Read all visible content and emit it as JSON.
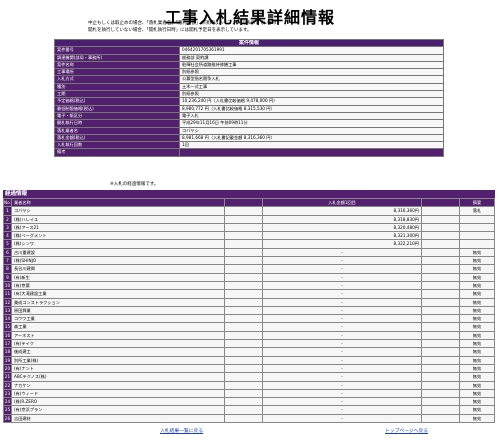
{
  "title": "工事入札結果詳細情報",
  "notes": [
    "中止もしくは取止めの場合、「落札業者名」「落札金額」の項目はハイフン(-)で表示しています。",
    "開札を執行していない場合、「開札執行日時」には開札予定日を表示しています。"
  ],
  "info": {
    "header": "案件情報",
    "rows": [
      {
        "label": "案件番号",
        "value": "0464201705361991"
      },
      {
        "label": "調達機関(部局・事務所)",
        "value": "総務部 契約課"
      },
      {
        "label": "案件名称",
        "value": "駐輝社会所道路維持修繕工事"
      },
      {
        "label": "工事場所",
        "value": "別紙参照"
      },
      {
        "label": "入札方式",
        "value": "公募型指名競争入札"
      },
      {
        "label": "種別",
        "value": "土木一式工事"
      },
      {
        "label": "工期",
        "value": "別紙参照"
      },
      {
        "label": "予定価格(税込)",
        "value": "10,236,240 円（入札書比較価格 9,478,000 円）"
      },
      {
        "label": "最低制限価格(税込)",
        "value": "8,980,772 円（入札書比較価格 8,315,530 円）"
      },
      {
        "label": "電子・紙区分",
        "value": "電子入札"
      },
      {
        "label": "開札執行日時",
        "value": "平成29年11月16日 午前09時11分"
      },
      {
        "label": "落札業者名",
        "value": "コバヤシ"
      },
      {
        "label": "落札金額(税込)",
        "value": "8,981,668 円（入札書記載金額 8,316,360 円）"
      },
      {
        "label": "入札執行回数",
        "value": "1回"
      },
      {
        "label": "備考",
        "value": ""
      }
    ]
  },
  "kc_note": "※入札の経過情報です。",
  "bids": {
    "section_title": "経過情報",
    "col_no": "No.",
    "col_name": "業者名称",
    "col_amount": "入札金額1回目",
    "col_remark": "摘要",
    "rows": [
      {
        "no": "1",
        "name": "コバヤシ",
        "amount": "8,316,360円",
        "remark": "落札"
      },
      {
        "no": "2",
        "name": "(株)ハレイユ",
        "amount": "8,318,830円",
        "remark": ""
      },
      {
        "no": "3",
        "name": "(株)アース21",
        "amount": "8,320,480円",
        "remark": ""
      },
      {
        "no": "4",
        "name": "(株)ベーグメント",
        "amount": "8,321,300円",
        "remark": ""
      },
      {
        "no": "5",
        "name": "(株)シンワ",
        "amount": "8,322,210円",
        "remark": ""
      },
      {
        "no": "6",
        "name": "古川重建設",
        "amount": "-",
        "remark": "無効"
      },
      {
        "no": "7",
        "name": "(株)SHINJO",
        "amount": "-",
        "remark": "無効"
      },
      {
        "no": "8",
        "name": "長谷川建興",
        "amount": "-",
        "remark": "無効"
      },
      {
        "no": "9",
        "name": "(有)新生",
        "amount": "-",
        "remark": "無効"
      },
      {
        "no": "10",
        "name": "(有)京葉",
        "amount": "-",
        "remark": "無効"
      },
      {
        "no": "11",
        "name": "(有)大滝建設工業",
        "amount": "-",
        "remark": "無効"
      },
      {
        "no": "12",
        "name": "美成コンストラクション",
        "amount": "-",
        "remark": "無効"
      },
      {
        "no": "13",
        "name": "原田興業",
        "amount": "-",
        "remark": "無効"
      },
      {
        "no": "14",
        "name": "コウワ工業",
        "amount": "-",
        "remark": "無効"
      },
      {
        "no": "15",
        "name": "森工業",
        "amount": "-",
        "remark": "無効"
      },
      {
        "no": "16",
        "name": "アーネスト",
        "amount": "-",
        "remark": "無効"
      },
      {
        "no": "17",
        "name": "(有)テイク",
        "amount": "-",
        "remark": "無効"
      },
      {
        "no": "18",
        "name": "後成建工",
        "amount": "-",
        "remark": "無効"
      },
      {
        "no": "19",
        "name": "別所工業(株)",
        "amount": "-",
        "remark": "無効"
      },
      {
        "no": "20",
        "name": "(有)ナント",
        "amount": "-",
        "remark": "無効"
      },
      {
        "no": "21",
        "name": "ABCテクノス(株)",
        "amount": "-",
        "remark": "無効"
      },
      {
        "no": "22",
        "name": "ナカケン",
        "amount": "-",
        "remark": "無効"
      },
      {
        "no": "23",
        "name": "(有)ウィード",
        "amount": "-",
        "remark": "無効"
      },
      {
        "no": "24",
        "name": "(株)R.ZERO",
        "amount": "-",
        "remark": "無効"
      },
      {
        "no": "25",
        "name": "(有)京浜プラン",
        "amount": "-",
        "remark": "無効"
      },
      {
        "no": "26",
        "name": "吉田建材",
        "amount": "-",
        "remark": "無効"
      }
    ]
  },
  "footer": {
    "back_link": "入札結果一覧に戻る",
    "top_link": "トップページへ戻る"
  }
}
